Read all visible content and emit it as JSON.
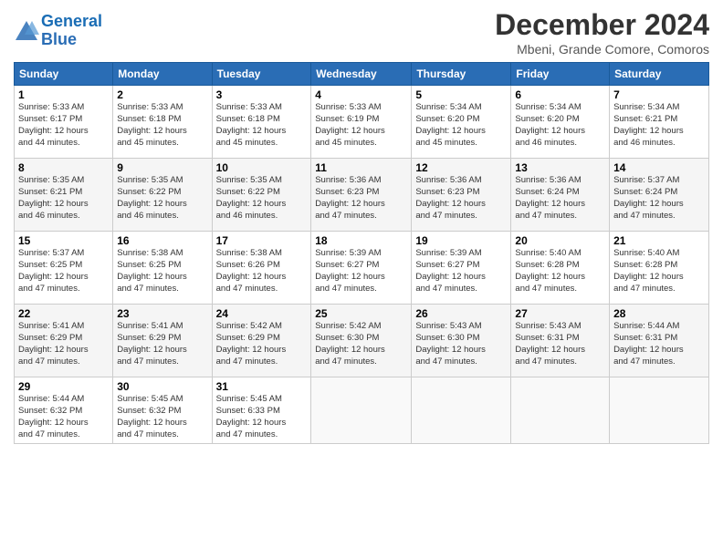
{
  "header": {
    "logo_line1": "General",
    "logo_line2": "Blue",
    "month": "December 2024",
    "location": "Mbeni, Grande Comore, Comoros"
  },
  "weekdays": [
    "Sunday",
    "Monday",
    "Tuesday",
    "Wednesday",
    "Thursday",
    "Friday",
    "Saturday"
  ],
  "weeks": [
    [
      {
        "day": "1",
        "info": "Sunrise: 5:33 AM\nSunset: 6:17 PM\nDaylight: 12 hours\nand 44 minutes."
      },
      {
        "day": "2",
        "info": "Sunrise: 5:33 AM\nSunset: 6:18 PM\nDaylight: 12 hours\nand 45 minutes."
      },
      {
        "day": "3",
        "info": "Sunrise: 5:33 AM\nSunset: 6:18 PM\nDaylight: 12 hours\nand 45 minutes."
      },
      {
        "day": "4",
        "info": "Sunrise: 5:33 AM\nSunset: 6:19 PM\nDaylight: 12 hours\nand 45 minutes."
      },
      {
        "day": "5",
        "info": "Sunrise: 5:34 AM\nSunset: 6:20 PM\nDaylight: 12 hours\nand 45 minutes."
      },
      {
        "day": "6",
        "info": "Sunrise: 5:34 AM\nSunset: 6:20 PM\nDaylight: 12 hours\nand 46 minutes."
      },
      {
        "day": "7",
        "info": "Sunrise: 5:34 AM\nSunset: 6:21 PM\nDaylight: 12 hours\nand 46 minutes."
      }
    ],
    [
      {
        "day": "8",
        "info": "Sunrise: 5:35 AM\nSunset: 6:21 PM\nDaylight: 12 hours\nand 46 minutes."
      },
      {
        "day": "9",
        "info": "Sunrise: 5:35 AM\nSunset: 6:22 PM\nDaylight: 12 hours\nand 46 minutes."
      },
      {
        "day": "10",
        "info": "Sunrise: 5:35 AM\nSunset: 6:22 PM\nDaylight: 12 hours\nand 46 minutes."
      },
      {
        "day": "11",
        "info": "Sunrise: 5:36 AM\nSunset: 6:23 PM\nDaylight: 12 hours\nand 47 minutes."
      },
      {
        "day": "12",
        "info": "Sunrise: 5:36 AM\nSunset: 6:23 PM\nDaylight: 12 hours\nand 47 minutes."
      },
      {
        "day": "13",
        "info": "Sunrise: 5:36 AM\nSunset: 6:24 PM\nDaylight: 12 hours\nand 47 minutes."
      },
      {
        "day": "14",
        "info": "Sunrise: 5:37 AM\nSunset: 6:24 PM\nDaylight: 12 hours\nand 47 minutes."
      }
    ],
    [
      {
        "day": "15",
        "info": "Sunrise: 5:37 AM\nSunset: 6:25 PM\nDaylight: 12 hours\nand 47 minutes."
      },
      {
        "day": "16",
        "info": "Sunrise: 5:38 AM\nSunset: 6:25 PM\nDaylight: 12 hours\nand 47 minutes."
      },
      {
        "day": "17",
        "info": "Sunrise: 5:38 AM\nSunset: 6:26 PM\nDaylight: 12 hours\nand 47 minutes."
      },
      {
        "day": "18",
        "info": "Sunrise: 5:39 AM\nSunset: 6:27 PM\nDaylight: 12 hours\nand 47 minutes."
      },
      {
        "day": "19",
        "info": "Sunrise: 5:39 AM\nSunset: 6:27 PM\nDaylight: 12 hours\nand 47 minutes."
      },
      {
        "day": "20",
        "info": "Sunrise: 5:40 AM\nSunset: 6:28 PM\nDaylight: 12 hours\nand 47 minutes."
      },
      {
        "day": "21",
        "info": "Sunrise: 5:40 AM\nSunset: 6:28 PM\nDaylight: 12 hours\nand 47 minutes."
      }
    ],
    [
      {
        "day": "22",
        "info": "Sunrise: 5:41 AM\nSunset: 6:29 PM\nDaylight: 12 hours\nand 47 minutes."
      },
      {
        "day": "23",
        "info": "Sunrise: 5:41 AM\nSunset: 6:29 PM\nDaylight: 12 hours\nand 47 minutes."
      },
      {
        "day": "24",
        "info": "Sunrise: 5:42 AM\nSunset: 6:29 PM\nDaylight: 12 hours\nand 47 minutes."
      },
      {
        "day": "25",
        "info": "Sunrise: 5:42 AM\nSunset: 6:30 PM\nDaylight: 12 hours\nand 47 minutes."
      },
      {
        "day": "26",
        "info": "Sunrise: 5:43 AM\nSunset: 6:30 PM\nDaylight: 12 hours\nand 47 minutes."
      },
      {
        "day": "27",
        "info": "Sunrise: 5:43 AM\nSunset: 6:31 PM\nDaylight: 12 hours\nand 47 minutes."
      },
      {
        "day": "28",
        "info": "Sunrise: 5:44 AM\nSunset: 6:31 PM\nDaylight: 12 hours\nand 47 minutes."
      }
    ],
    [
      {
        "day": "29",
        "info": "Sunrise: 5:44 AM\nSunset: 6:32 PM\nDaylight: 12 hours\nand 47 minutes."
      },
      {
        "day": "30",
        "info": "Sunrise: 5:45 AM\nSunset: 6:32 PM\nDaylight: 12 hours\nand 47 minutes."
      },
      {
        "day": "31",
        "info": "Sunrise: 5:45 AM\nSunset: 6:33 PM\nDaylight: 12 hours\nand 47 minutes."
      },
      null,
      null,
      null,
      null
    ]
  ]
}
